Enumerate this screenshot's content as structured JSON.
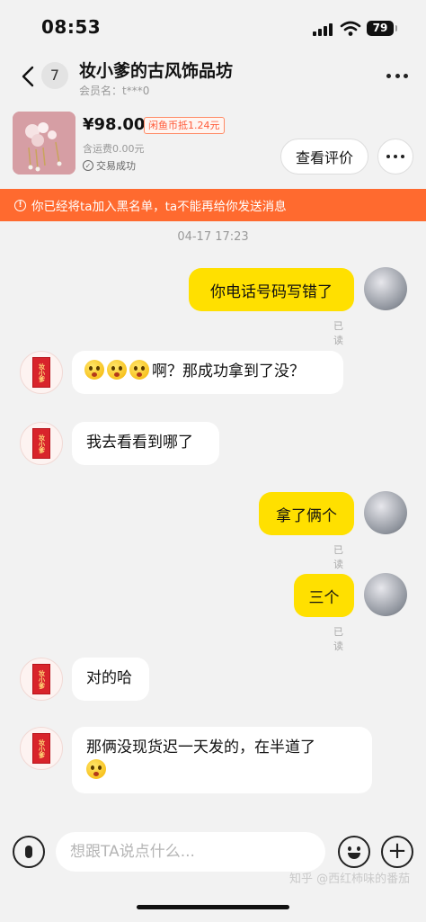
{
  "status_bar": {
    "time": "08:53",
    "battery": "79"
  },
  "header": {
    "unread_count": "7",
    "shop_name": "妆小爹的古风饰品坊",
    "member_label": "会员名：t***0"
  },
  "product": {
    "price": "¥98.00",
    "coin_badge": "闲鱼币抵1.24元",
    "shipping": "含运费0.00元",
    "status": "交易成功",
    "review_button": "查看评价"
  },
  "banner": {
    "text": "你已经将ta加入黑名单，ta不能再给你发送消息"
  },
  "timestamp": "04-17 17:23",
  "avatar_seal_text": "妆小爹",
  "messages": [
    {
      "side": "me",
      "text": "你电话号码写错了",
      "status": "已读"
    },
    {
      "side": "other",
      "text": "啊？那成功拿到了没？",
      "emoji_prefix": "🫢🫢🫢"
    },
    {
      "side": "other",
      "text": "我去看看到哪了"
    },
    {
      "side": "me",
      "text": "拿了俩个",
      "status": "已读"
    },
    {
      "side": "me",
      "text": "三个",
      "status": "已读"
    },
    {
      "side": "other",
      "text": "对的哈"
    },
    {
      "side": "other",
      "text": "那俩没现货迟一天发的，在半道了",
      "emoji_suffix": "😣"
    }
  ],
  "input": {
    "placeholder": "想跟TA说点什么..."
  },
  "watermark": "知乎 @西红柿味的番茄",
  "icons": [
    "back-icon",
    "more-icon",
    "check-icon",
    "warning-icon",
    "mic-icon",
    "emoji-icon",
    "plus-icon"
  ]
}
